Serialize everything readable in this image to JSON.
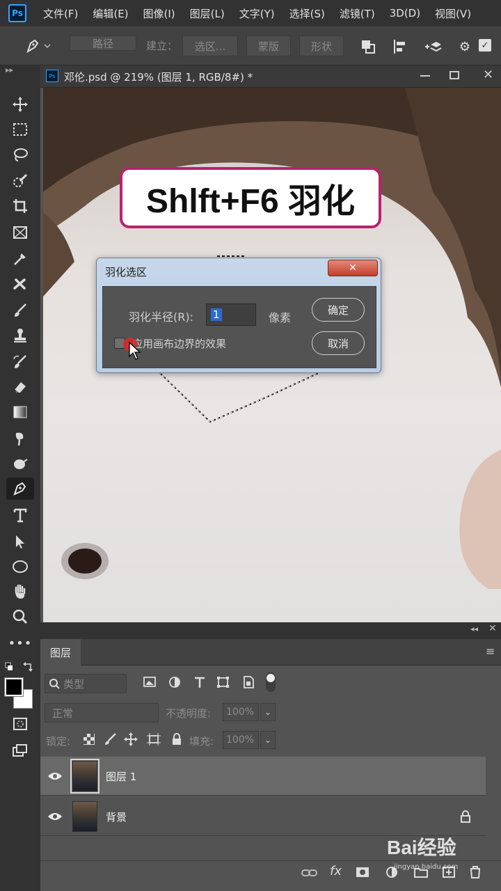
{
  "app": {
    "logo": "Ps"
  },
  "menu": [
    "文件(F)",
    "编辑(E)",
    "图像(I)",
    "图层(L)",
    "文字(Y)",
    "选择(S)",
    "滤镜(T)",
    "3D(D)",
    "视图(V)"
  ],
  "options": {
    "path_mode": "路径",
    "make_label": "建立：",
    "selection_btn": "选区...",
    "mask_btn": "蒙版",
    "shape_btn": "形状"
  },
  "document": {
    "title": "邓伦.psd @ 219% (图层 1, RGB/8#) *"
  },
  "banner": {
    "text": "Shlft+F6 羽化"
  },
  "feather_dialog": {
    "title": "羽化选区",
    "close_label": "✕",
    "radius_label": "羽化半径(R):",
    "radius_value": "1",
    "radius_unit": "像素",
    "checkbox_label": "应用画布边界的效果",
    "checkbox_checked": false,
    "ok_label": "确定",
    "cancel_label": "取消"
  },
  "layers_panel": {
    "tab_label": "图层",
    "filter_label": "类型",
    "blend_mode": "正常",
    "opacity_label": "不透明度:",
    "opacity_value": "100%",
    "lock_label": "锁定:",
    "fill_label": "填充:",
    "fill_value": "100%",
    "layers": [
      {
        "name": "图层 1",
        "selected": true,
        "locked": false
      },
      {
        "name": "背景",
        "selected": false,
        "locked": true
      }
    ],
    "footer_fx": "fx"
  },
  "watermark": {
    "text": "Bai经验",
    "sub": "jingyan.baidu.com"
  },
  "colors": {
    "accent_select": "#2d6bd0",
    "banner_border": "#b8226d",
    "close_red": "#c1402c"
  }
}
